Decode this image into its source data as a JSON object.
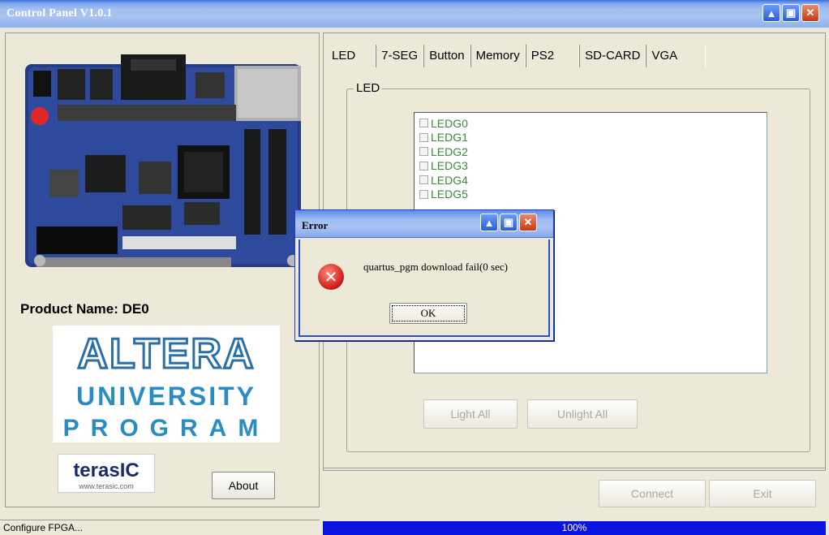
{
  "window": {
    "title": "Control Panel V1.0.1"
  },
  "left": {
    "product_name": "Product Name: DE0",
    "about_label": "About",
    "altera_logo_text": "ALTERA",
    "university_text": "UNIVERSITY",
    "program_text": "PROGRAM",
    "terasic_logo_text": "terasIC",
    "terasic_url": "www.terasic.com"
  },
  "tabs": [
    {
      "label": "LED"
    },
    {
      "label": "7-SEG"
    },
    {
      "label": "Button"
    },
    {
      "label": "Memory"
    },
    {
      "label": "PS2"
    },
    {
      "label": "SD-CARD"
    },
    {
      "label": "VGA"
    }
  ],
  "led_panel": {
    "group_label": "LED",
    "items": [
      {
        "label": "LEDG0"
      },
      {
        "label": "LEDG1"
      },
      {
        "label": "LEDG2"
      },
      {
        "label": "LEDG3"
      },
      {
        "label": "LEDG4"
      },
      {
        "label": "LEDG5"
      }
    ],
    "light_all_label": "Light All",
    "unlight_all_label": "Unlight All"
  },
  "bottom": {
    "connect_label": "Connect",
    "exit_label": "Exit"
  },
  "status": {
    "text": "Configure FPGA...",
    "progress_text": "100%",
    "progress_value": 1.0
  },
  "dialog": {
    "title": "Error",
    "message": "quartus_pgm download fail(0 sec)",
    "ok_label": "OK"
  }
}
